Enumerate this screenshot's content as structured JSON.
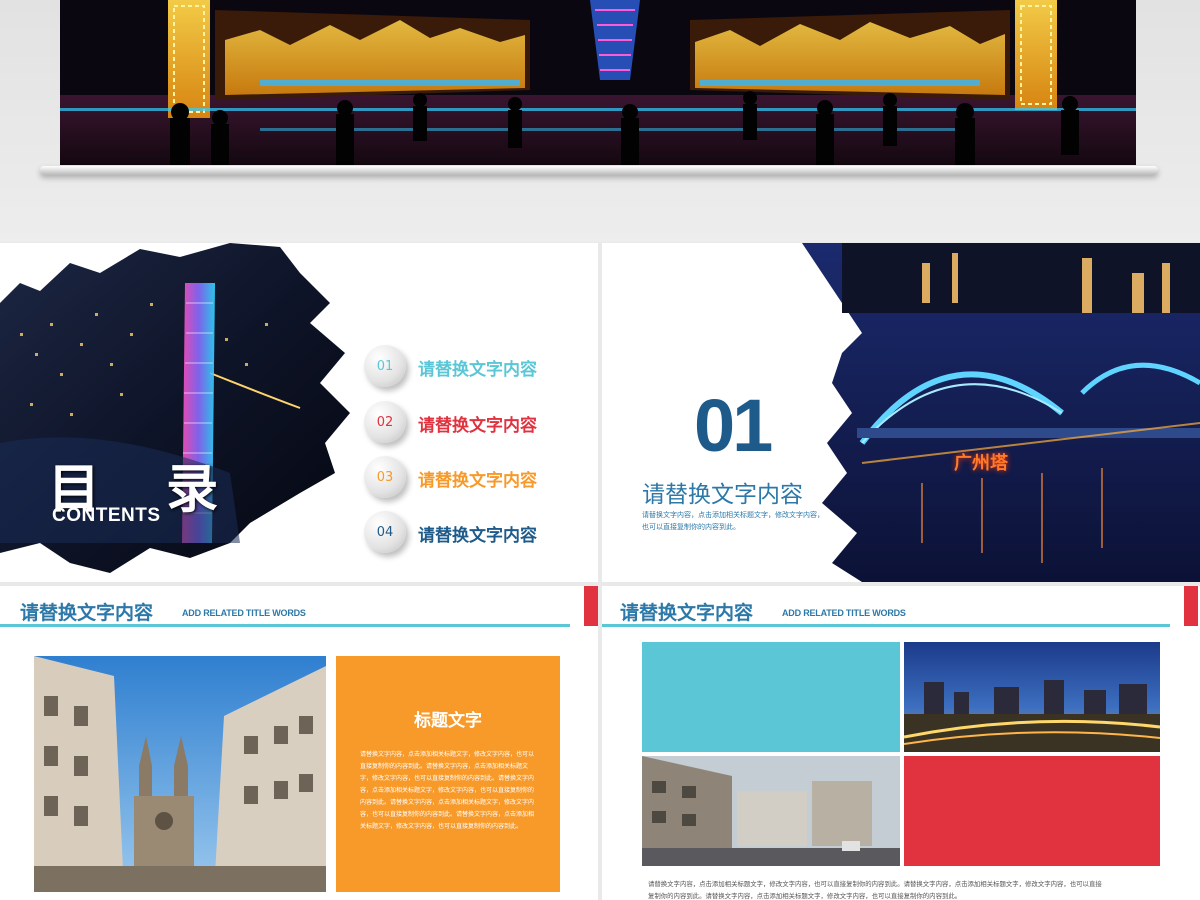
{
  "colors": {
    "navy": "#1f5b8a",
    "blue": "#2c78a8",
    "cyan": "#5bc7d6",
    "red": "#e1323f",
    "orange": "#f79a2a"
  },
  "toc": {
    "heading": "目 录",
    "subheading": "CONTENTS",
    "items": [
      {
        "num": "01",
        "label": "请替换文字内容",
        "color": "#5bc7d6"
      },
      {
        "num": "02",
        "label": "请替换文字内容",
        "color": "#e1323f"
      },
      {
        "num": "03",
        "label": "请替换文字内容",
        "color": "#f79a2a"
      },
      {
        "num": "04",
        "label": "请替换文字内容",
        "color": "#1f5b8a"
      }
    ]
  },
  "section": {
    "number": "01",
    "title": "请替换文字内容",
    "desc_line1": "请替换文字内容，点击添加相关标题文字，修改文字内容，",
    "desc_line2": "也可以直接复制你的内容到此。",
    "photo_sign": "广州塔"
  },
  "content1": {
    "title": "请替换文字内容",
    "subtitle": "ADD RELATED TITLE WORDS",
    "box_title": "标题文字",
    "box_text": "请替换文字内容，点击添加相关标题文字，修改文字内容，也可以直接复制你的内容到此。请替换文字内容，点击添加相关标题文字，修改文字内容，也可以直接复制你的内容到此。请替换文字内容，点击添加相关标题文字，修改文字内容，也可以直接复制你的内容到此。请替换文字内容，点击添加相关标题文字，修改文字内容，也可以直接复制你的内容到此。请替换文字内容，点击添加相关标题文字，修改文字内容，也可以直接复制你的内容到此。"
  },
  "content2": {
    "title": "请替换文字内容",
    "subtitle": "ADD RELATED TITLE WORDS",
    "body_line1": "请替换文字内容，点击添加相关标题文字，修改文字内容，也可以直接复制你的内容到此。请替换文字内容，点击添加相关标题文字，修改文字内容，也可以直接",
    "body_line2": "复制你的内容到此。请替换文字内容，点击添加相关标题文字，修改文字内容，也可以直接复制你的内容到此。"
  }
}
